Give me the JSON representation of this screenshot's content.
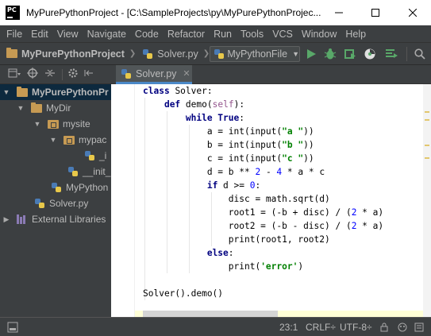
{
  "window": {
    "app_icon": "pycharm-icon",
    "app_icon_text": "PC",
    "title": "MyPurePythonProject - [C:\\SampleProjects\\py\\MyPurePythonProjec..."
  },
  "menu": [
    "File",
    "Edit",
    "View",
    "Navigate",
    "Code",
    "Refactor",
    "Run",
    "Tools",
    "VCS",
    "Window",
    "Help"
  ],
  "breadcrumb": {
    "project": "MyPurePythonProject",
    "file": "Solver.py"
  },
  "run_config": {
    "label": "MyPythonFile"
  },
  "tab": {
    "label": "Solver.py"
  },
  "tree": {
    "items": [
      {
        "label": "MyPurePythonPr",
        "icon": "folder-icon"
      },
      {
        "label": "MyDir",
        "icon": "folder-icon"
      },
      {
        "label": "mysite",
        "icon": "package-icon"
      },
      {
        "label": "mypac",
        "icon": "package-icon"
      },
      {
        "label": "_i",
        "icon": "python-file-icon"
      },
      {
        "label": "__init_",
        "icon": "python-file-icon"
      },
      {
        "label": "MyPython",
        "icon": "python-file-icon"
      },
      {
        "label": "Solver.py",
        "icon": "python-file-icon"
      },
      {
        "label": "External Libraries",
        "icon": "library-icon"
      }
    ]
  },
  "code": {
    "lines": [
      "class Solver:",
      "    def demo(self):",
      "        while True:",
      "            a = int(input(\"a \"))",
      "            b = int(input(\"b \"))",
      "            c = int(input(\"c \"))",
      "            d = b ** 2 - 4 * a * c",
      "            if d >= 0:",
      "                disc = math.sqrt(d)",
      "                root1 = (-b + disc) / (2 * a)",
      "                root2 = (-b - disc) / (2 * a)",
      "                print(root1, root2)",
      "            else:",
      "                print('error')",
      "",
      "Solver().demo()"
    ]
  },
  "status": {
    "position": "23:1",
    "line_sep": "CRLF÷",
    "encoding": "UTF-8÷"
  }
}
